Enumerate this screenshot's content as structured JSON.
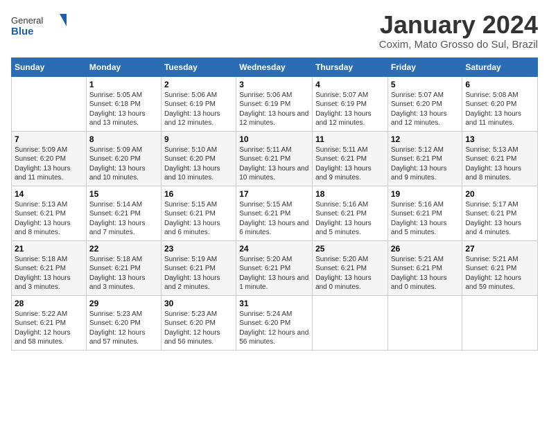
{
  "header": {
    "logo_general": "General",
    "logo_blue": "Blue",
    "month_title": "January 2024",
    "subtitle": "Coxim, Mato Grosso do Sul, Brazil"
  },
  "calendar": {
    "days_of_week": [
      "Sunday",
      "Monday",
      "Tuesday",
      "Wednesday",
      "Thursday",
      "Friday",
      "Saturday"
    ],
    "weeks": [
      [
        {
          "num": "",
          "sunrise": "",
          "sunset": "",
          "daylight": "",
          "empty": true
        },
        {
          "num": "1",
          "sunrise": "Sunrise: 5:05 AM",
          "sunset": "Sunset: 6:18 PM",
          "daylight": "Daylight: 13 hours and 13 minutes."
        },
        {
          "num": "2",
          "sunrise": "Sunrise: 5:06 AM",
          "sunset": "Sunset: 6:19 PM",
          "daylight": "Daylight: 13 hours and 12 minutes."
        },
        {
          "num": "3",
          "sunrise": "Sunrise: 5:06 AM",
          "sunset": "Sunset: 6:19 PM",
          "daylight": "Daylight: 13 hours and 12 minutes."
        },
        {
          "num": "4",
          "sunrise": "Sunrise: 5:07 AM",
          "sunset": "Sunset: 6:19 PM",
          "daylight": "Daylight: 13 hours and 12 minutes."
        },
        {
          "num": "5",
          "sunrise": "Sunrise: 5:07 AM",
          "sunset": "Sunset: 6:20 PM",
          "daylight": "Daylight: 13 hours and 12 minutes."
        },
        {
          "num": "6",
          "sunrise": "Sunrise: 5:08 AM",
          "sunset": "Sunset: 6:20 PM",
          "daylight": "Daylight: 13 hours and 11 minutes."
        }
      ],
      [
        {
          "num": "7",
          "sunrise": "Sunrise: 5:09 AM",
          "sunset": "Sunset: 6:20 PM",
          "daylight": "Daylight: 13 hours and 11 minutes."
        },
        {
          "num": "8",
          "sunrise": "Sunrise: 5:09 AM",
          "sunset": "Sunset: 6:20 PM",
          "daylight": "Daylight: 13 hours and 10 minutes."
        },
        {
          "num": "9",
          "sunrise": "Sunrise: 5:10 AM",
          "sunset": "Sunset: 6:20 PM",
          "daylight": "Daylight: 13 hours and 10 minutes."
        },
        {
          "num": "10",
          "sunrise": "Sunrise: 5:11 AM",
          "sunset": "Sunset: 6:21 PM",
          "daylight": "Daylight: 13 hours and 10 minutes."
        },
        {
          "num": "11",
          "sunrise": "Sunrise: 5:11 AM",
          "sunset": "Sunset: 6:21 PM",
          "daylight": "Daylight: 13 hours and 9 minutes."
        },
        {
          "num": "12",
          "sunrise": "Sunrise: 5:12 AM",
          "sunset": "Sunset: 6:21 PM",
          "daylight": "Daylight: 13 hours and 9 minutes."
        },
        {
          "num": "13",
          "sunrise": "Sunrise: 5:13 AM",
          "sunset": "Sunset: 6:21 PM",
          "daylight": "Daylight: 13 hours and 8 minutes."
        }
      ],
      [
        {
          "num": "14",
          "sunrise": "Sunrise: 5:13 AM",
          "sunset": "Sunset: 6:21 PM",
          "daylight": "Daylight: 13 hours and 8 minutes."
        },
        {
          "num": "15",
          "sunrise": "Sunrise: 5:14 AM",
          "sunset": "Sunset: 6:21 PM",
          "daylight": "Daylight: 13 hours and 7 minutes."
        },
        {
          "num": "16",
          "sunrise": "Sunrise: 5:15 AM",
          "sunset": "Sunset: 6:21 PM",
          "daylight": "Daylight: 13 hours and 6 minutes."
        },
        {
          "num": "17",
          "sunrise": "Sunrise: 5:15 AM",
          "sunset": "Sunset: 6:21 PM",
          "daylight": "Daylight: 13 hours and 6 minutes."
        },
        {
          "num": "18",
          "sunrise": "Sunrise: 5:16 AM",
          "sunset": "Sunset: 6:21 PM",
          "daylight": "Daylight: 13 hours and 5 minutes."
        },
        {
          "num": "19",
          "sunrise": "Sunrise: 5:16 AM",
          "sunset": "Sunset: 6:21 PM",
          "daylight": "Daylight: 13 hours and 5 minutes."
        },
        {
          "num": "20",
          "sunrise": "Sunrise: 5:17 AM",
          "sunset": "Sunset: 6:21 PM",
          "daylight": "Daylight: 13 hours and 4 minutes."
        }
      ],
      [
        {
          "num": "21",
          "sunrise": "Sunrise: 5:18 AM",
          "sunset": "Sunset: 6:21 PM",
          "daylight": "Daylight: 13 hours and 3 minutes."
        },
        {
          "num": "22",
          "sunrise": "Sunrise: 5:18 AM",
          "sunset": "Sunset: 6:21 PM",
          "daylight": "Daylight: 13 hours and 3 minutes."
        },
        {
          "num": "23",
          "sunrise": "Sunrise: 5:19 AM",
          "sunset": "Sunset: 6:21 PM",
          "daylight": "Daylight: 13 hours and 2 minutes."
        },
        {
          "num": "24",
          "sunrise": "Sunrise: 5:20 AM",
          "sunset": "Sunset: 6:21 PM",
          "daylight": "Daylight: 13 hours and 1 minute."
        },
        {
          "num": "25",
          "sunrise": "Sunrise: 5:20 AM",
          "sunset": "Sunset: 6:21 PM",
          "daylight": "Daylight: 13 hours and 0 minutes."
        },
        {
          "num": "26",
          "sunrise": "Sunrise: 5:21 AM",
          "sunset": "Sunset: 6:21 PM",
          "daylight": "Daylight: 13 hours and 0 minutes."
        },
        {
          "num": "27",
          "sunrise": "Sunrise: 5:21 AM",
          "sunset": "Sunset: 6:21 PM",
          "daylight": "Daylight: 12 hours and 59 minutes."
        }
      ],
      [
        {
          "num": "28",
          "sunrise": "Sunrise: 5:22 AM",
          "sunset": "Sunset: 6:21 PM",
          "daylight": "Daylight: 12 hours and 58 minutes."
        },
        {
          "num": "29",
          "sunrise": "Sunrise: 5:23 AM",
          "sunset": "Sunset: 6:20 PM",
          "daylight": "Daylight: 12 hours and 57 minutes."
        },
        {
          "num": "30",
          "sunrise": "Sunrise: 5:23 AM",
          "sunset": "Sunset: 6:20 PM",
          "daylight": "Daylight: 12 hours and 56 minutes."
        },
        {
          "num": "31",
          "sunrise": "Sunrise: 5:24 AM",
          "sunset": "Sunset: 6:20 PM",
          "daylight": "Daylight: 12 hours and 56 minutes."
        },
        {
          "num": "",
          "sunrise": "",
          "sunset": "",
          "daylight": "",
          "empty": true
        },
        {
          "num": "",
          "sunrise": "",
          "sunset": "",
          "daylight": "",
          "empty": true
        },
        {
          "num": "",
          "sunrise": "",
          "sunset": "",
          "daylight": "",
          "empty": true
        }
      ]
    ]
  }
}
